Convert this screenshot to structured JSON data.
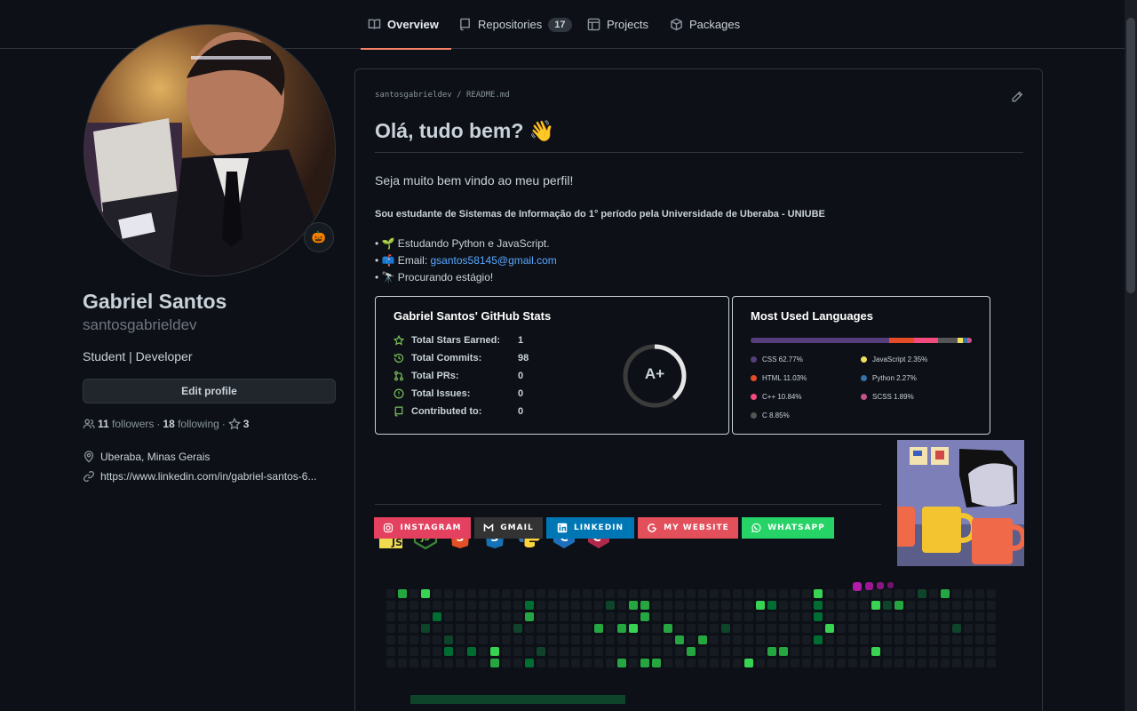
{
  "tabs": [
    {
      "label": "Overview",
      "active": true
    },
    {
      "label": "Repositories",
      "count": "17"
    },
    {
      "label": "Projects"
    },
    {
      "label": "Packages"
    }
  ],
  "profile": {
    "full_name": "Gabriel Santos",
    "username": "santosgabrieldev",
    "bio": "Student | Developer",
    "edit_label": "Edit profile",
    "followers_count": "11",
    "followers_label": "followers",
    "following_count": "18",
    "following_label": "following",
    "stars": "3",
    "location": "Uberaba, Minas Gerais",
    "website": "https://www.linkedin.com/in/gabriel-santos-6...",
    "status_emoji": "🎃"
  },
  "readme": {
    "owner": "santosgabrieldev",
    "file": "README.md",
    "heading": "Olá, tudo bem? 👋",
    "welcome": "Seja muito bem vindo ao meu perfil!",
    "study": "Sou estudante de Sistemas de Informação do 1° período pela Universidade de Uberaba - UNIUBE",
    "item1": "• 🌱 Estudando Python e JavaScript.",
    "item2_prefix": "• 📫 Email: ",
    "item2_link": "gsantos58145@gmail.com",
    "item3": "• 🔭 Procurando estágio!"
  },
  "stats": {
    "title": "Gabriel Santos' GitHub Stats",
    "rows": [
      {
        "label": "Total Stars Earned:",
        "value": "1",
        "icon": "star-icon"
      },
      {
        "label": "Total Commits:",
        "value": "98",
        "icon": "history-icon"
      },
      {
        "label": "Total PRs:",
        "value": "0",
        "icon": "pull-request-icon"
      },
      {
        "label": "Total Issues:",
        "value": "0",
        "icon": "issue-icon"
      },
      {
        "label": "Contributed to:",
        "value": "0",
        "icon": "repo-icon"
      }
    ],
    "grade": "A+"
  },
  "languages": {
    "title": "Most Used Languages",
    "items": [
      {
        "name": "CSS 62.77%",
        "color": "#563d7c"
      },
      {
        "name": "JavaScript 2.35%",
        "color": "#f1e05a"
      },
      {
        "name": "HTML 11.03%",
        "color": "#e34c26"
      },
      {
        "name": "Python 2.27%",
        "color": "#3572A5"
      },
      {
        "name": "C++ 10.84%",
        "color": "#f34b7d"
      },
      {
        "name": "SCSS 1.89%",
        "color": "#c6538c"
      },
      {
        "name": "C 8.85%",
        "color": "#555555"
      }
    ]
  },
  "badges": [
    {
      "label": "INSTAGRAM",
      "color": "#e4405f"
    },
    {
      "label": "GMAIL",
      "color": "#333333"
    },
    {
      "label": "LINKEDIN",
      "color": "#0077b5"
    },
    {
      "label": "MY WEBSITE",
      "color": "#e34f5b"
    },
    {
      "label": "WHATSAPP",
      "color": "#25d366"
    }
  ],
  "tech_icons": [
    "javascript-icon",
    "nodejs-icon",
    "html5-icon",
    "css3-icon",
    "python-icon",
    "c-icon",
    "cpp-icon"
  ]
}
